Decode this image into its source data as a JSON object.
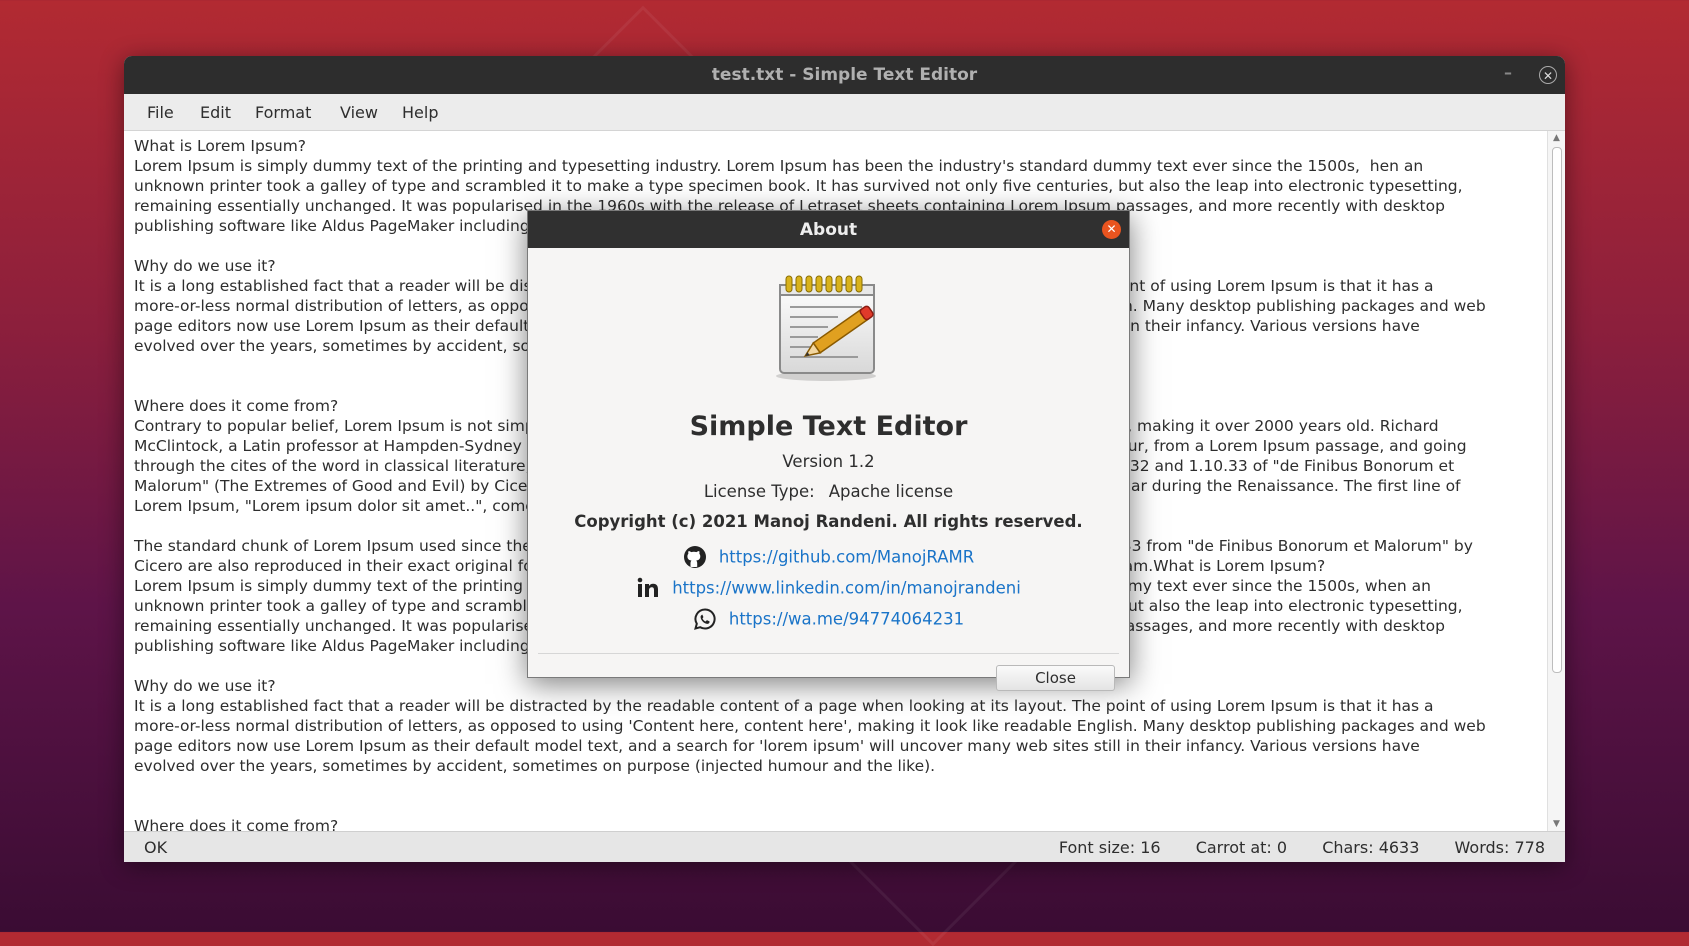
{
  "window": {
    "title": "test.txt - Simple Text Editor",
    "minimize_glyph": "–",
    "close_glyph": "✕"
  },
  "menu": [
    "File",
    "Edit",
    "Format",
    "View",
    "Help"
  ],
  "editor": {
    "lines": [
      "What is Lorem Ipsum?",
      "Lorem Ipsum is simply dummy text of the printing and typesetting industry. Lorem Ipsum has been the industry's standard dummy text ever since the 1500s,  hen an",
      "unknown printer took a galley of type and scrambled it to make a type specimen book. It has survived not only five centuries, but also the leap into electronic typesetting,",
      "remaining essentially unchanged. It was popularised in the 1960s with the release of Letraset sheets containing Lorem Ipsum passages, and more recently with desktop",
      "publishing software like Aldus PageMaker including versions of Lorem Ipsum.",
      "",
      "Why do we use it?",
      "It is a long established fact that a reader will be distracted by the readable content of a page when looking at its layout. The point of using Lorem Ipsum is that it has a",
      "more-or-less normal distribution of letters, as opposed to using 'Content here, content here', making it look like readable English. Many desktop publishing packages and web",
      "page editors now use Lorem Ipsum as their default model text, and a search for 'lorem ipsum' will uncover many web sites still in their infancy. Various versions have",
      "evolved over the years, sometimes by accident, sometimes on purpose (injected humour and the like).",
      "",
      "",
      "Where does it come from?",
      "Contrary to popular belief, Lorem Ipsum is not simply random text. It has roots in a piece of classical Latin literature from 45 BC, making it over 2000 years old. Richard",
      "McClintock, a Latin professor at Hampden-Sydney College in Virginia, looked up one of the more obscure Latin words, consectetur, from a Lorem Ipsum passage, and going",
      "through the cites of the word in classical literature, discovered the undoubtable source. Lorem Ipsum comes from sections 1.10.32 and 1.10.33 of \"de Finibus Bonorum et",
      "Malorum\" (The Extremes of Good and Evil) by Cicero, written in 45 BC. This book is a treatise on the theory of ethics, very popular during the Renaissance. The first line of",
      "Lorem Ipsum, \"Lorem ipsum dolor sit amet..\", comes from a line in section 1.10.32.",
      "",
      "The standard chunk of Lorem Ipsum used since the 1500s is reproduced below for those interested. Sections 1.10.32 and 1.10.33 from \"de Finibus Bonorum et Malorum\" by",
      "Cicero are also reproduced in their exact original form, accompanied by English versions from the 1914 translation by H. Rackham.What is Lorem Ipsum?",
      "Lorem Ipsum is simply dummy text of the printing and typesetting industry. Lorem Ipsum has been the industry's standard dummy text ever since the 1500s, when an",
      "unknown printer took a galley of type and scrambled it to make a type specimen book. It has survived not only five centuries, but also the leap into electronic typesetting,",
      "remaining essentially unchanged. It was popularised in the 1960s with the release of Letraset sheets containing Lorem Ipsum passages, and more recently with desktop",
      "publishing software like Aldus PageMaker including versions of Lorem Ipsum.",
      "",
      "Why do we use it?",
      "It is a long established fact that a reader will be distracted by the readable content of a page when looking at its layout. The point of using Lorem Ipsum is that it has a",
      "more-or-less normal distribution of letters, as opposed to using 'Content here, content here', making it look like readable English. Many desktop publishing packages and web",
      "page editors now use Lorem Ipsum as their default model text, and a search for 'lorem ipsum' will uncover many web sites still in their infancy. Various versions have",
      "evolved over the years, sometimes by accident, sometimes on purpose (injected humour and the like).",
      "",
      "",
      "Where does it come from?"
    ]
  },
  "status": {
    "left": "OK",
    "font_size": "Font size: 16",
    "caret": "Carrot at: 0",
    "chars": "Chars: 4633",
    "words": "Words: 778"
  },
  "dialog": {
    "title": "About",
    "close_glyph": "✕",
    "app_icon": "notepad-pencil-icon",
    "app_name": "Simple Text Editor",
    "version": "Version 1.2",
    "license_label": "License Type:",
    "license_value": "Apache license",
    "copyright": "Copyright (c) 2021 Manoj Randeni. All rights reserved.",
    "links": [
      {
        "icon": "github-icon",
        "url": "https://github.com/ManojRAMR"
      },
      {
        "icon": "linkedin-icon",
        "url": "https://www.linkedin.com/in/manojrandeni"
      },
      {
        "icon": "whatsapp-icon",
        "url": "https://wa.me/94774064231"
      }
    ],
    "close_button": "Close"
  },
  "colors": {
    "desktop_top": "#b22a32",
    "desktop_bottom": "#3a0c33",
    "titlebar": "#2d2d2d",
    "link": "#1a74c8",
    "dialog_close": "#e9541f"
  }
}
